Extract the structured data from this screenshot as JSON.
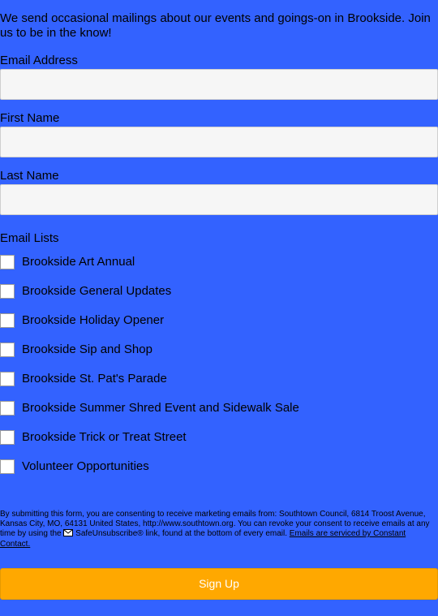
{
  "intro": "We send occasional mailings about our events and goings-on in Brookside. Join us to be in the know!",
  "fields": {
    "email_label": "Email Address",
    "email_value": "",
    "first_label": "First Name",
    "first_value": "",
    "last_label": "Last Name",
    "last_value": ""
  },
  "email_lists": {
    "label": "Email Lists",
    "items": [
      {
        "label": "Brookside Art Annual",
        "checked": false
      },
      {
        "label": "Brookside General Updates",
        "checked": false
      },
      {
        "label": "Brookside Holiday Opener",
        "checked": false
      },
      {
        "label": "Brookside Sip and Shop",
        "checked": false
      },
      {
        "label": "Brookside St. Pat's Parade",
        "checked": false
      },
      {
        "label": "Brookside Summer Shred Event and Sidewalk Sale",
        "checked": false
      },
      {
        "label": "Brookside Trick or Treat Street",
        "checked": false
      },
      {
        "label": "Volunteer Opportunities",
        "checked": false
      }
    ]
  },
  "disclaimer": {
    "text_before": "By submitting this form, you are consenting to receive marketing emails from: Southtown Council, 6814 Troost Avenue, Kansas City, MO, 64131 United States, http://www.southtown.org. You can revoke your consent to receive emails at any time by using the ",
    "text_after": " SafeUnsubscribe® link, found at the bottom of every email. ",
    "link_text": "Emails are serviced by Constant Contact.",
    "icon": "envelope-icon"
  },
  "submit_label": "Sign Up",
  "colors": {
    "background": "#3362ff",
    "button": "#ffa800",
    "input": "#f6f6f6"
  }
}
